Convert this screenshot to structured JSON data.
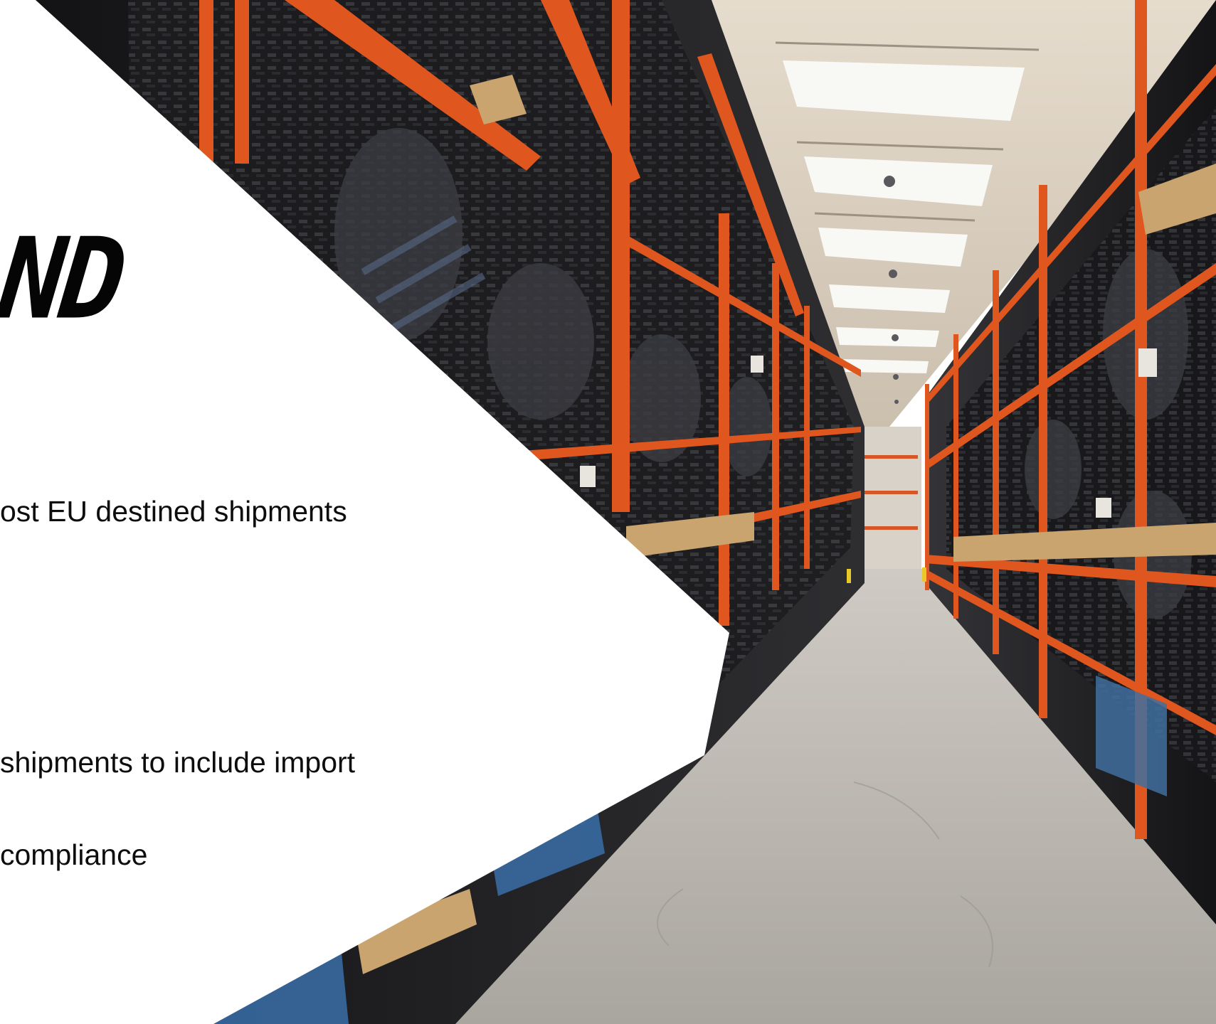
{
  "slide": {
    "heading": "AND",
    "bullets": [
      "ost EU destined shipments",
      "shipments to include import",
      "compliance"
    ]
  },
  "photo": {
    "icon": "warehouse-aisle-photo",
    "colors": {
      "racking": "#e0561f",
      "tyres": "#1b1b1d",
      "floor": "#bdbab4",
      "ceiling": "#e2d7c8",
      "skylight": "#f7f7f4",
      "pallet": "#c9a46e"
    }
  }
}
